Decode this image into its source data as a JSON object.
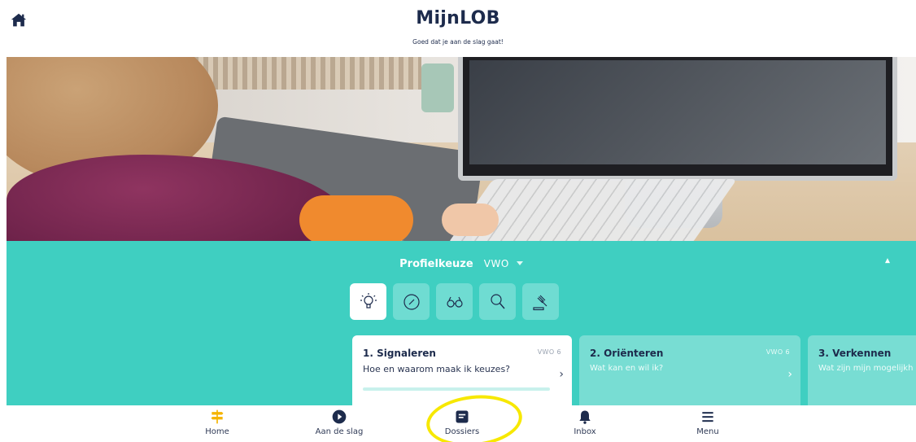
{
  "header": {
    "title": "MijnLOB",
    "subtitle": "Goed dat je aan de slag gaat!"
  },
  "panel": {
    "title": "Profielkeuze",
    "level": "VWO",
    "step_icons": [
      "lightbulb-icon",
      "compass-icon",
      "binoculars-icon",
      "magnifier-icon",
      "gavel-icon"
    ],
    "cards": [
      {
        "title": "1. Signaleren",
        "level": "VWO 6",
        "subtitle": "Hoe en waarom maak ik keuzes?",
        "progress": 0
      },
      {
        "title": "2. Oriënteren",
        "level": "VWO 6",
        "subtitle": "Wat kan en wil ik?"
      },
      {
        "title": "3. Verkennen",
        "subtitle": "Wat zijn mijn mogelijkh"
      }
    ]
  },
  "nav": {
    "items": [
      {
        "label": "Home",
        "icon": "signpost-icon"
      },
      {
        "label": "Aan de slag",
        "icon": "play-icon"
      },
      {
        "label": "Dossiers",
        "icon": "dossier-icon"
      },
      {
        "label": "Inbox",
        "icon": "bell-icon"
      },
      {
        "label": "Menu",
        "icon": "hamburger-icon"
      }
    ]
  },
  "colors": {
    "accent": "#3fcfc1",
    "nav_active": "#f5b400",
    "annotation": "#f7e800",
    "text_dark": "#1d2b4c"
  }
}
